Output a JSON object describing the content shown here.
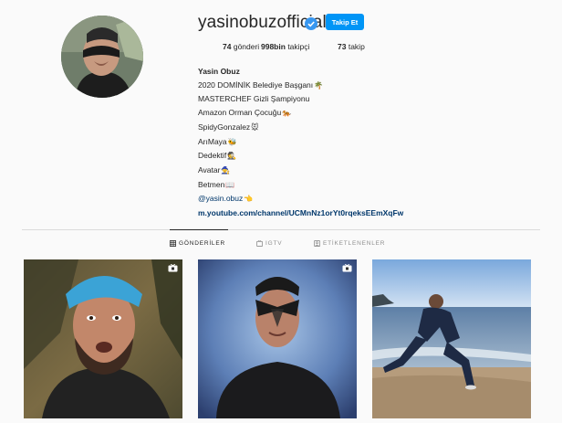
{
  "profile": {
    "username": "yasinobuzofficial",
    "follow_label": "Takip Et",
    "stats": {
      "posts_value": "74",
      "posts_label": "gönderi",
      "followers_value": "998bin",
      "followers_label": "takipçi",
      "following_value": "73",
      "following_label": "takip"
    },
    "bio": {
      "name": "Yasin Obuz",
      "lines": [
        "2020 DOMİNİK Belediye Başganı",
        "MASTERCHEF Gizli Şampiyonu",
        "Amazon Orman Çocuğu",
        "SpidyGonzalez",
        "ArıMaya",
        "Dedektif",
        "Avatar",
        "Betmen"
      ],
      "emojis": [
        "palm-tree",
        "",
        "tiger",
        "mouse",
        "bee",
        "detective",
        "mage",
        "bat-book"
      ],
      "mention": "@yasin.obuz",
      "mention_emoji": "pointing-hand",
      "link": "m.youtube.com/channel/UCMnNz1orYt0rqeksEEmXqFw"
    }
  },
  "tabs": [
    {
      "label": "GÖNDERİLER",
      "icon": "grid-icon",
      "active": true
    },
    {
      "label": "IGTV",
      "icon": "igtv-icon",
      "active": false
    },
    {
      "label": "ETİKETLENENLER",
      "icon": "tag-icon",
      "active": false
    }
  ],
  "posts": [
    {
      "type": "video",
      "subject": "bearded man in blue bandana"
    },
    {
      "type": "video",
      "subject": "man with face paint"
    },
    {
      "type": "photo",
      "subject": "man stretching on beach"
    }
  ],
  "colors": {
    "accent": "#0095f6",
    "link": "#00376b",
    "background": "#fafafa",
    "divider": "#dbdbdb",
    "muted": "#8e8e8e"
  }
}
